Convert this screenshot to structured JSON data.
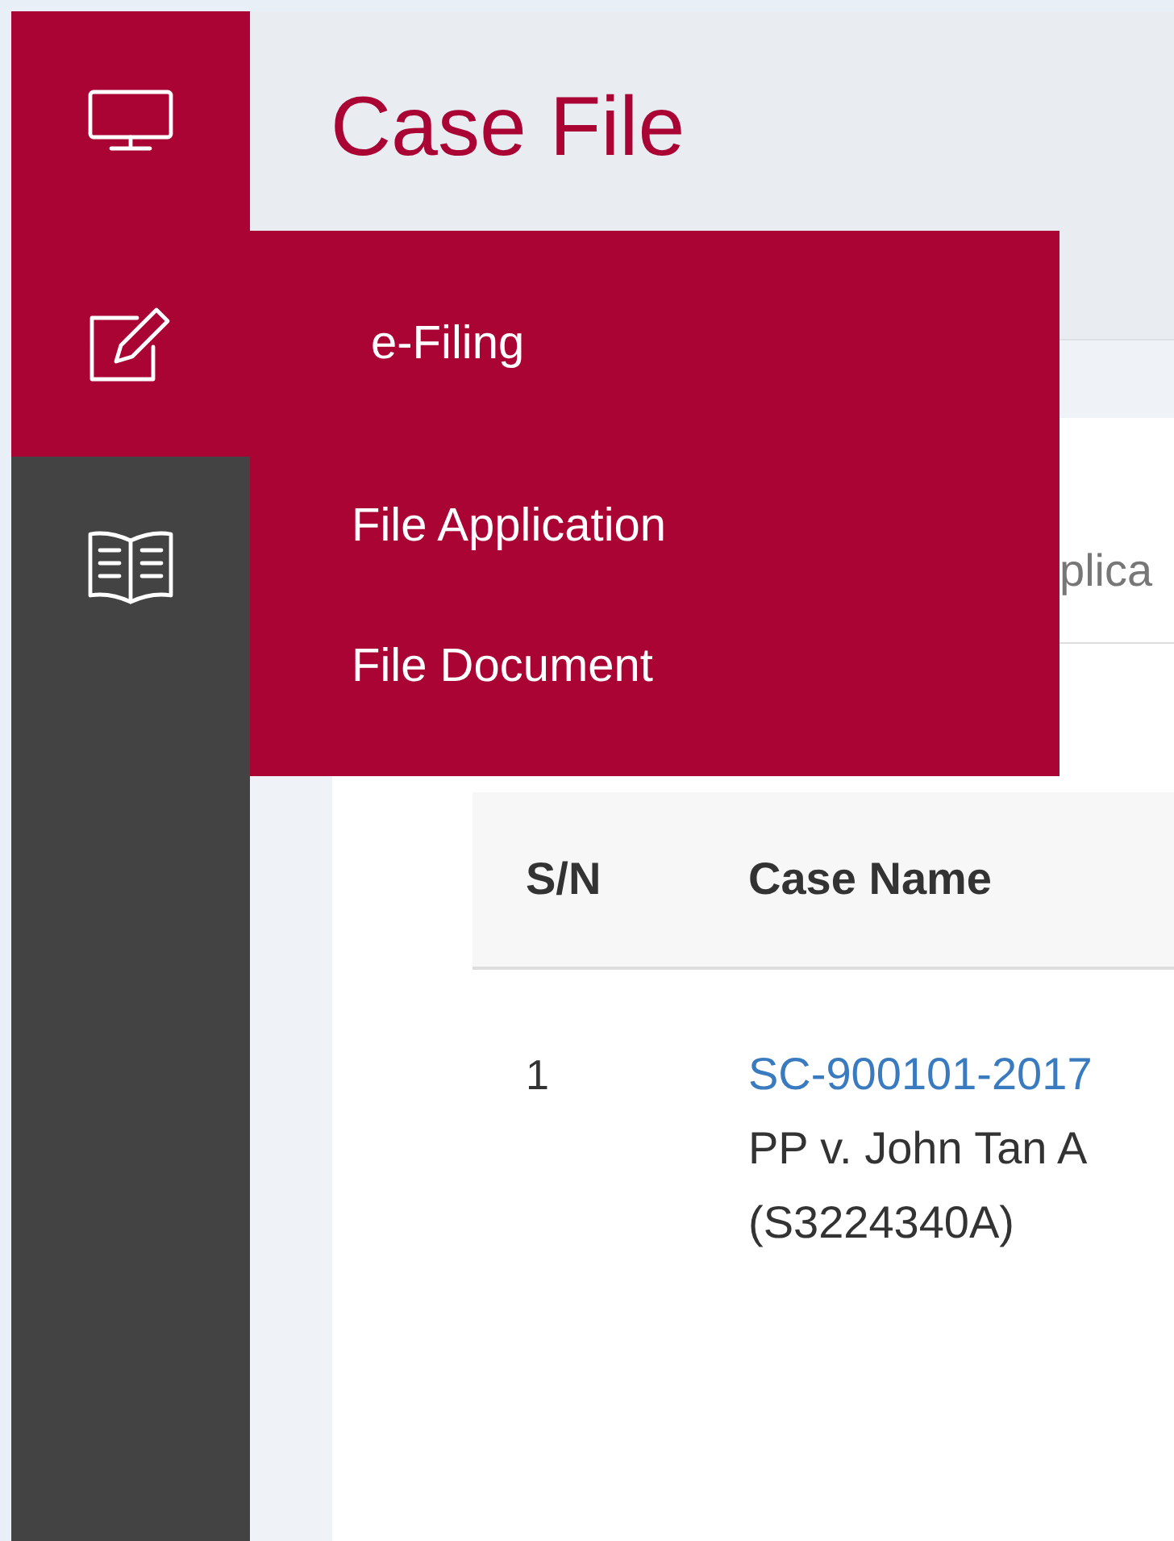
{
  "sidebar": {
    "items": [
      {
        "kind": "monitor",
        "highlighted": true
      },
      {
        "kind": "edit",
        "highlighted": true
      },
      {
        "kind": "book",
        "highlighted": false
      }
    ]
  },
  "flyout": {
    "title": "e-Filing",
    "items": [
      "File Application",
      "File Document"
    ]
  },
  "page_header": {
    "title": "Case File"
  },
  "tabs": [
    {
      "label": "plica",
      "selected": false
    }
  ],
  "table": {
    "columns": [
      "S/N",
      "Case Name"
    ],
    "rows": [
      {
        "sn": "1",
        "case_link": "SC-900101-2017",
        "case_lines": [
          "PP v. John Tan A",
          "(S3224340A)"
        ]
      }
    ]
  }
}
